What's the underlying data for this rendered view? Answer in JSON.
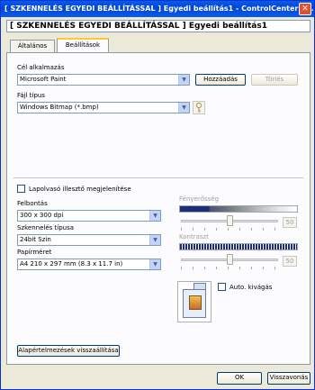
{
  "window": {
    "title": "[ SZKENNELÉS EGYEDI BEÁLLÍTÁSSAL ] Egyedi beállítás1 - ControlCenter3 ...",
    "close_glyph": "✕"
  },
  "header": {
    "label": "[ SZKENNELÉS EGYEDI BEÁLLÍTÁSSAL ]   Egyedi beállítás1"
  },
  "tabs": [
    {
      "label": "Általános",
      "active": false
    },
    {
      "label": "Beállítások",
      "active": true
    }
  ],
  "target_app": {
    "label": "Cél alkalmazás",
    "value": "Microsoft Paint",
    "add_button": "Hozzáadás",
    "delete_button": "Törlés"
  },
  "file_type": {
    "label": "Fájl típus",
    "value": "Windows Bitmap (*.bmp)"
  },
  "show_scanner_interface": {
    "label": "Lapolvasó illesztő megjelenítése",
    "checked": false
  },
  "resolution": {
    "label": "Felbontás",
    "value": "300 x 300 dpi"
  },
  "scan_type": {
    "label": "Szkennelés típusa",
    "value": "24bit Szín"
  },
  "paper_size": {
    "label": "Papírméret",
    "value": "A4 210 x 297 mm (8.3 x 11.7 in)"
  },
  "brightness": {
    "label": "Fényerősség",
    "value": "50",
    "level": 0.5
  },
  "contrast": {
    "label": "Kontraszt",
    "value": "50",
    "level": 0.5
  },
  "auto_crop": {
    "label": "Auto. kivágás",
    "checked": false
  },
  "reset_button": "Alapértelmezések visszaállítása",
  "footer": {
    "ok": "OK",
    "cancel": "Visszavonás"
  },
  "icons": {
    "dropdown": "▼"
  },
  "colors": {
    "titlebar": "#0a5ce8",
    "tab_accent": "#ffc83c",
    "close": "#e0512d"
  }
}
